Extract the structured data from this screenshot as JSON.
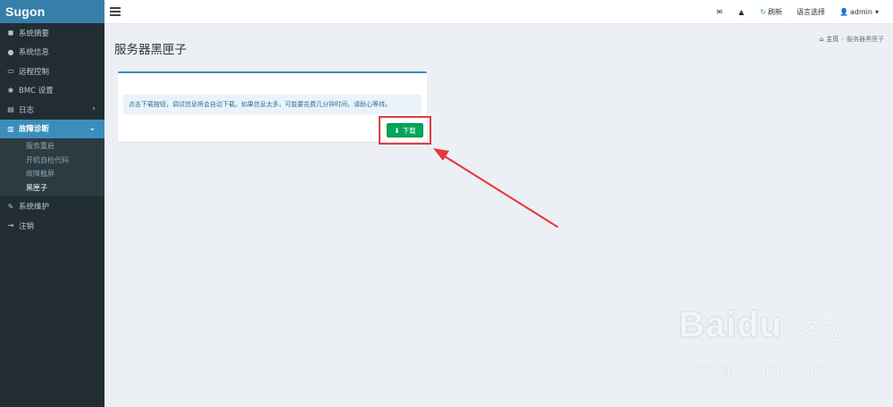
{
  "app": {
    "logo": "Sugon"
  },
  "sidebar": {
    "items": [
      {
        "icon": "dashboard-icon",
        "glyph": "◼",
        "label": "系统摘要"
      },
      {
        "icon": "info-icon",
        "glyph": "●",
        "label": "系统信息"
      },
      {
        "icon": "monitor-icon",
        "glyph": "▭",
        "label": "远程控制"
      },
      {
        "icon": "gear-icon",
        "glyph": "✱",
        "label": "BMC 设置"
      },
      {
        "icon": "log-icon",
        "glyph": "▤",
        "label": "日志",
        "caret": "›"
      },
      {
        "icon": "chart-icon",
        "glyph": "▥",
        "label": "故障诊断",
        "caret": "⌄"
      },
      {
        "icon": "wrench-icon",
        "glyph": "✎",
        "label": "系统维护"
      },
      {
        "icon": "logout-icon",
        "glyph": "⇥",
        "label": "注销"
      }
    ],
    "subitems": [
      {
        "label": "服务重启"
      },
      {
        "label": "开机自检代码"
      },
      {
        "label": "故障截屏"
      },
      {
        "label": "黑匣子"
      }
    ]
  },
  "header": {
    "mail_glyph": "✉",
    "alert_glyph": "▲",
    "refresh_glyph": "↻",
    "refresh_label": "刷新",
    "language_label": "语言选择",
    "user_glyph": "👤",
    "user_label": "admin",
    "user_caret": "▾"
  },
  "page": {
    "title": "服务器黑匣子",
    "breadcrumb": {
      "home_glyph": "⌂",
      "home": "主页",
      "sep": "›",
      "current": "服务器黑匣子"
    }
  },
  "box": {
    "message": "点击下载按钮，调试信息将会自动下载。如果信息太多，可能要花费几分钟时间，请耐心等待。",
    "download_glyph": "⬇",
    "download_label": "下载"
  },
  "watermark": {
    "main": "Bai",
    "paw": "du",
    "cn": "经验",
    "sub": "jingyan.baidu.com"
  },
  "colors": {
    "sidebar": "#222d32",
    "logo": "#367fa9",
    "active": "#3c8dbc",
    "button": "#00a65a",
    "highlight": "#e23b3b"
  }
}
